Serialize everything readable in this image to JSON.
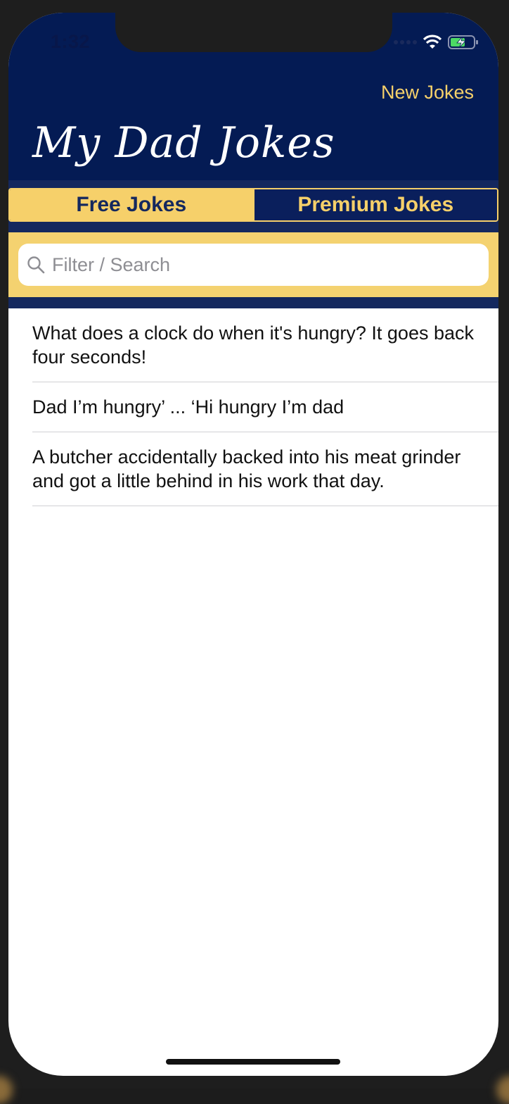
{
  "status": {
    "time": "1:32"
  },
  "nav": {
    "new_jokes_label": "New Jokes",
    "title": "My Dad Jokes"
  },
  "tabs": [
    {
      "label": "Free Jokes",
      "selected": true
    },
    {
      "label": "Premium Jokes",
      "selected": false
    }
  ],
  "search": {
    "placeholder": "Filter / Search",
    "value": ""
  },
  "jokes": [
    {
      "text": "What does a clock do when it's hungry? It goes back four seconds!"
    },
    {
      "text": "Dad I’m hungry’ ... ‘Hi hungry I’m dad"
    },
    {
      "text": "A butcher accidentally backed into his meat grinder and got a little behind in his work that day."
    }
  ],
  "colors": {
    "header_navy": "#041b54",
    "accent_gold": "#f6d06a",
    "segment_navy": "#14285e"
  },
  "icons": {
    "search": "magnifier-icon",
    "wifi": "wifi-icon",
    "battery": "battery-charging-icon"
  }
}
